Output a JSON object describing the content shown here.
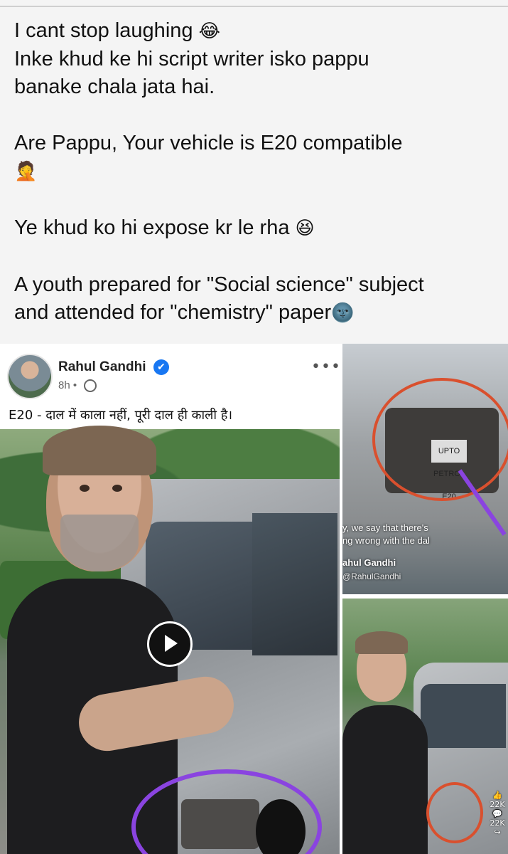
{
  "post": {
    "line1": "I cant stop laughing",
    "line1_emoji": "😂",
    "line2": "Inke khud ke hi script writer isko pappu",
    "line3": "banake chala jata hai.",
    "line4": "Are Pappu, Your vehicle is E20 compatible",
    "line4_emoji": "🤦",
    "line5": "Ye khud ko hi expose kr le rha",
    "line5_emoji": "😆",
    "line6": "A youth prepared for \"Social science\" subject",
    "line7": "and attended for \"chemistry\" paper",
    "line7_emoji": "🌚"
  },
  "fb_card": {
    "author": "Rahul Gandhi",
    "verified_icon": "✔",
    "time": "8h •",
    "caption": "E20 - दाल में काला नहीं, पूरी दाल ही काली है।",
    "more_label": "•••"
  },
  "side_video": {
    "subtitle1": "y, we say that there's",
    "subtitle2": "ng wrong with the dal",
    "name": "ahul Gandhi",
    "handle": "@RahulGandhi",
    "label": "UPTO PETROL E20"
  },
  "reel": {
    "likes": "22K",
    "comments": "22K"
  }
}
